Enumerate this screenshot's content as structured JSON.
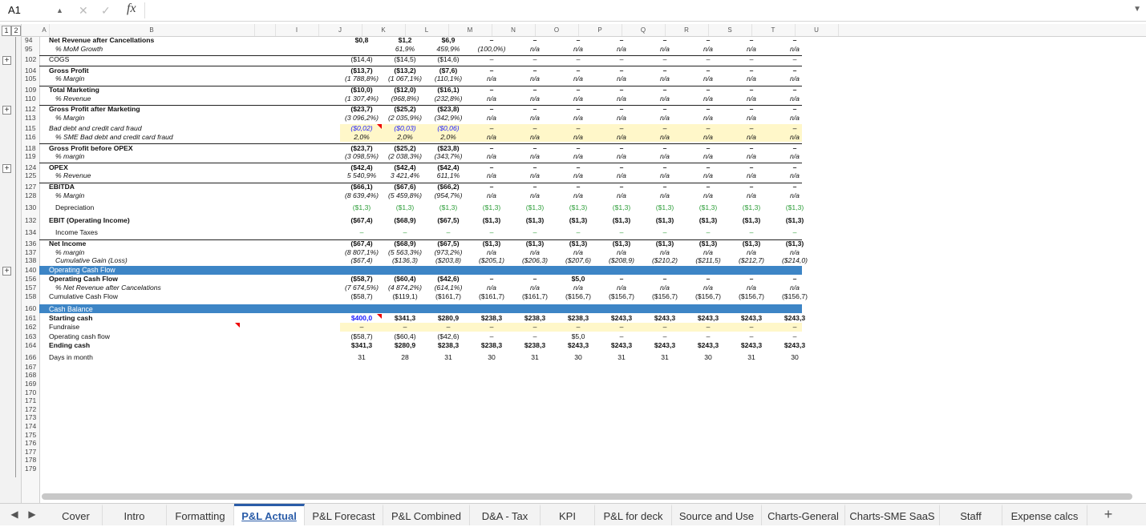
{
  "formula_bar": {
    "name_box": "A1",
    "cancel_icon": "✕",
    "enter_icon": "✓",
    "fx_label": "fx",
    "formula": ""
  },
  "outline_levels": [
    "1",
    "2"
  ],
  "columns": [
    {
      "letter": "A",
      "w": 12
    },
    {
      "letter": "B",
      "w": 256
    },
    {
      "letter": "",
      "w": 26
    },
    {
      "letter": "I",
      "w": 54
    },
    {
      "letter": "J",
      "w": 54
    },
    {
      "letter": "K",
      "w": 54
    },
    {
      "letter": "L",
      "w": 54
    },
    {
      "letter": "M",
      "w": 54
    },
    {
      "letter": "N",
      "w": 54
    },
    {
      "letter": "O",
      "w": 54
    },
    {
      "letter": "P",
      "w": 54
    },
    {
      "letter": "Q",
      "w": 54
    },
    {
      "letter": "R",
      "w": 54
    },
    {
      "letter": "S",
      "w": 54
    },
    {
      "letter": "T",
      "w": 54
    },
    {
      "letter": "U",
      "w": 54
    }
  ],
  "data_columns": [
    "K",
    "L",
    "M",
    "N",
    "O",
    "P",
    "Q",
    "R",
    "S",
    "T",
    "U"
  ],
  "rows": [
    {
      "n": "94",
      "label": "Net Revenue after Cancellations",
      "style": "bold",
      "vals": [
        "$0,8",
        "$1,2",
        "$6,9",
        "–",
        "–",
        "–",
        "–",
        "–",
        "–",
        "–",
        "–"
      ]
    },
    {
      "n": "95",
      "label": "% MoM Growth",
      "style": "ital",
      "indent": 1,
      "vals": [
        "",
        "61,9%",
        "459,9%",
        "(100,0%)",
        "n/a",
        "n/a",
        "n/a",
        "n/a",
        "n/a",
        "n/a",
        "n/a"
      ]
    },
    {
      "n": "102",
      "label": "COGS",
      "style": "",
      "vals": [
        "($14,4)",
        "($14,5)",
        "($14,6)",
        "–",
        "–",
        "–",
        "–",
        "–",
        "–",
        "–",
        "–"
      ],
      "top": true
    },
    {
      "n": "104",
      "label": "Gross Profit",
      "style": "bold",
      "vals": [
        "($13,7)",
        "($13,2)",
        "($7,6)",
        "–",
        "–",
        "–",
        "–",
        "–",
        "–",
        "–",
        "–"
      ],
      "top": true
    },
    {
      "n": "105",
      "label": "% Margin",
      "style": "ital",
      "indent": 1,
      "vals": [
        "(1 788,8%)",
        "(1 067,1%)",
        "(110,1%)",
        "n/a",
        "n/a",
        "n/a",
        "n/a",
        "n/a",
        "n/a",
        "n/a",
        "n/a"
      ]
    },
    {
      "n": "109",
      "label": "Total Marketing",
      "style": "bold",
      "vals": [
        "($10,0)",
        "($12,0)",
        "($16,1)",
        "–",
        "–",
        "–",
        "–",
        "–",
        "–",
        "–",
        "–"
      ],
      "top": true
    },
    {
      "n": "110",
      "label": "% Revenue",
      "style": "ital",
      "indent": 1,
      "vals": [
        "(1 307,4%)",
        "(968,8%)",
        "(232,8%)",
        "n/a",
        "n/a",
        "n/a",
        "n/a",
        "n/a",
        "n/a",
        "n/a",
        "n/a"
      ]
    },
    {
      "n": "112",
      "label": "Gross Profit after Marketing",
      "style": "bold",
      "vals": [
        "($23,7)",
        "($25,2)",
        "($23,8)",
        "–",
        "–",
        "–",
        "–",
        "–",
        "–",
        "–",
        "–"
      ],
      "top": true
    },
    {
      "n": "113",
      "label": "% Margin",
      "style": "ital",
      "indent": 1,
      "vals": [
        "(3 096,2%)",
        "(2 035,9%)",
        "(342,9%)",
        "n/a",
        "n/a",
        "n/a",
        "n/a",
        "n/a",
        "n/a",
        "n/a",
        "n/a"
      ]
    },
    {
      "n": "115",
      "label": "Bad debt and credit card fraud",
      "style": "ital",
      "vals": [
        "($0,02)",
        "($0,03)",
        "($0,06)",
        "–",
        "–",
        "–",
        "–",
        "–",
        "–",
        "–",
        "–"
      ],
      "yellow": true,
      "blue": true
    },
    {
      "n": "116",
      "label": "% SME Bad debt and credit card fraud",
      "style": "ital",
      "indent": 1,
      "vals": [
        "2,0%",
        "2,0%",
        "2,0%",
        "n/a",
        "n/a",
        "n/a",
        "n/a",
        "n/a",
        "n/a",
        "n/a",
        "n/a"
      ],
      "yellow": true
    },
    {
      "n": "118",
      "label": "Gross Profit before OPEX",
      "style": "bold",
      "vals": [
        "($23,7)",
        "($25,2)",
        "($23,8)",
        "–",
        "–",
        "–",
        "–",
        "–",
        "–",
        "–",
        "–"
      ],
      "top": true
    },
    {
      "n": "119",
      "label": "% margin",
      "style": "ital",
      "indent": 1,
      "vals": [
        "(3 098,5%)",
        "(2 038,3%)",
        "(343,7%)",
        "n/a",
        "n/a",
        "n/a",
        "n/a",
        "n/a",
        "n/a",
        "n/a",
        "n/a"
      ]
    },
    {
      "n": "124",
      "label": "OPEX",
      "style": "bold",
      "vals": [
        "($42,4)",
        "($42,4)",
        "($42,4)",
        "–",
        "–",
        "–",
        "–",
        "–",
        "–",
        "–",
        "–"
      ],
      "top": true
    },
    {
      "n": "125",
      "label": "% Revenue",
      "style": "ital",
      "indent": 1,
      "vals": [
        "5 540,9%",
        "3 421,4%",
        "611,1%",
        "n/a",
        "n/a",
        "n/a",
        "n/a",
        "n/a",
        "n/a",
        "n/a",
        "n/a"
      ]
    },
    {
      "n": "127",
      "label": "EBITDA",
      "style": "bold",
      "vals": [
        "($66,1)",
        "($67,6)",
        "($66,2)",
        "–",
        "–",
        "–",
        "–",
        "–",
        "–",
        "–",
        "–"
      ],
      "top": true
    },
    {
      "n": "128",
      "label": "% Margin",
      "style": "ital",
      "indent": 1,
      "vals": [
        "(8 639,4%)",
        "(5 459,8%)",
        "(954,7%)",
        "n/a",
        "n/a",
        "n/a",
        "n/a",
        "n/a",
        "n/a",
        "n/a",
        "n/a"
      ]
    },
    {
      "n": "130",
      "label": "Depreciation",
      "style": "",
      "indent": 1,
      "vals": [
        "($1,3)",
        "($1,3)",
        "($1,3)",
        "($1,3)",
        "($1,3)",
        "($1,3)",
        "($1,3)",
        "($1,3)",
        "($1,3)",
        "($1,3)",
        "($1,3)"
      ],
      "green": true
    },
    {
      "n": "132",
      "label": "EBIT (Operating Income)",
      "style": "bold",
      "vals": [
        "($67,4)",
        "($68,9)",
        "($67,5)",
        "($1,3)",
        "($1,3)",
        "($1,3)",
        "($1,3)",
        "($1,3)",
        "($1,3)",
        "($1,3)",
        "($1,3)"
      ]
    },
    {
      "n": "134",
      "label": "Income Taxes",
      "style": "",
      "indent": 1,
      "vals": [
        "–",
        "–",
        "–",
        "–",
        "–",
        "–",
        "–",
        "–",
        "–",
        "–",
        "–"
      ],
      "green": true
    },
    {
      "n": "136",
      "label": "Net Income",
      "style": "bold",
      "vals": [
        "($67,4)",
        "($68,9)",
        "($67,5)",
        "($1,3)",
        "($1,3)",
        "($1,3)",
        "($1,3)",
        "($1,3)",
        "($1,3)",
        "($1,3)",
        "($1,3)"
      ],
      "top": true
    },
    {
      "n": "137",
      "label": "% margin",
      "style": "ital",
      "indent": 1,
      "vals": [
        "(8 807,1%)",
        "(5 563,3%)",
        "(973,2%)",
        "n/a",
        "n/a",
        "n/a",
        "n/a",
        "n/a",
        "n/a",
        "n/a",
        "n/a"
      ]
    },
    {
      "n": "138",
      "label": "Cumulative Gain (Loss)",
      "style": "ital",
      "indent": 1,
      "vals": [
        "($67,4)",
        "($136,3)",
        "($203,8)",
        "($205,1)",
        "($206,3)",
        "($207,6)",
        "($208,9)",
        "($210,2)",
        "($211,5)",
        "($212,7)",
        "($214,0)"
      ]
    },
    {
      "n": "140",
      "label": "Operating Cash Flow",
      "band": true
    },
    {
      "n": "156",
      "label": "Operating Cash Flow",
      "style": "bold",
      "vals": [
        "($58,7)",
        "($60,4)",
        "($42,6)",
        "–",
        "–",
        "$5,0",
        "–",
        "–",
        "–",
        "–",
        "–"
      ]
    },
    {
      "n": "157",
      "label": "% Net Revenue after Cancelations",
      "style": "ital",
      "indent": 1,
      "vals": [
        "(7 674,5%)",
        "(4 874,2%)",
        "(614,1%)",
        "n/a",
        "n/a",
        "n/a",
        "n/a",
        "n/a",
        "n/a",
        "n/a",
        "n/a"
      ]
    },
    {
      "n": "158",
      "label": "Cumulative Cash Flow",
      "style": "",
      "vals": [
        "($58,7)",
        "($119,1)",
        "($161,7)",
        "($161,7)",
        "($161,7)",
        "($156,7)",
        "($156,7)",
        "($156,7)",
        "($156,7)",
        "($156,7)",
        "($156,7)"
      ]
    },
    {
      "n": "160",
      "label": "Cash Balance",
      "band": true
    },
    {
      "n": "161",
      "label": "Starting cash",
      "style": "bold",
      "vals": [
        "$400,0",
        "$341,3",
        "$280,9",
        "$238,3",
        "$238,3",
        "$238,3",
        "$243,3",
        "$243,3",
        "$243,3",
        "$243,3",
        "$243,3"
      ]
    },
    {
      "n": "162",
      "label": "Fundraise",
      "style": "",
      "vals": [
        "–",
        "–",
        "–",
        "–",
        "–",
        "–",
        "–",
        "–",
        "–",
        "–",
        "–"
      ],
      "yellow": true
    },
    {
      "n": "163",
      "label": "Operating cash flow",
      "style": "",
      "vals": [
        "($58,7)",
        "($60,4)",
        "($42,6)",
        "–",
        "–",
        "$5,0",
        "–",
        "–",
        "–",
        "–",
        "–"
      ]
    },
    {
      "n": "164",
      "label": "Ending cash",
      "style": "bold",
      "vals": [
        "$341,3",
        "$280,9",
        "$238,3",
        "$238,3",
        "$238,3",
        "$243,3",
        "$243,3",
        "$243,3",
        "$243,3",
        "$243,3",
        "$243,3"
      ]
    },
    {
      "n": "166",
      "label": "Days in month",
      "style": "",
      "vals": [
        "31",
        "28",
        "31",
        "30",
        "31",
        "30",
        "31",
        "31",
        "30",
        "31",
        "30"
      ]
    },
    {
      "n": "167"
    },
    {
      "n": "168"
    },
    {
      "n": "169"
    },
    {
      "n": "170"
    },
    {
      "n": "171"
    },
    {
      "n": "172"
    },
    {
      "n": "173"
    },
    {
      "n": "174"
    },
    {
      "n": "175"
    },
    {
      "n": "176"
    },
    {
      "n": "177"
    },
    {
      "n": "178"
    },
    {
      "n": "179"
    }
  ],
  "sheet_tabs": [
    {
      "label": "Cover",
      "w": 66
    },
    {
      "label": "Intro",
      "w": 80
    },
    {
      "label": "Formatting",
      "w": 84
    },
    {
      "label": "P&L Actual",
      "w": 88,
      "active": true
    },
    {
      "label": "P&L Forecast",
      "w": 98
    },
    {
      "label": "P&L Combined",
      "w": 108
    },
    {
      "label": "D&A - Tax",
      "w": 88
    },
    {
      "label": "KPI",
      "w": 68
    },
    {
      "label": "P&L for deck",
      "w": 96
    },
    {
      "label": "Source and Use",
      "w": 112
    },
    {
      "label": "Charts-General",
      "w": 104
    },
    {
      "label": "Charts-SME SaaS",
      "w": 118
    },
    {
      "label": "Staff",
      "w": 78
    },
    {
      "label": "Expense calcs",
      "w": 106
    }
  ],
  "add_sheet": "+",
  "nav_prev": "◀",
  "nav_next": "▶",
  "colors": {
    "band": "#3d85c6",
    "input_blue": "#1a1aff",
    "link_green": "#2e9e3a",
    "yellow": "#fff7c9"
  }
}
